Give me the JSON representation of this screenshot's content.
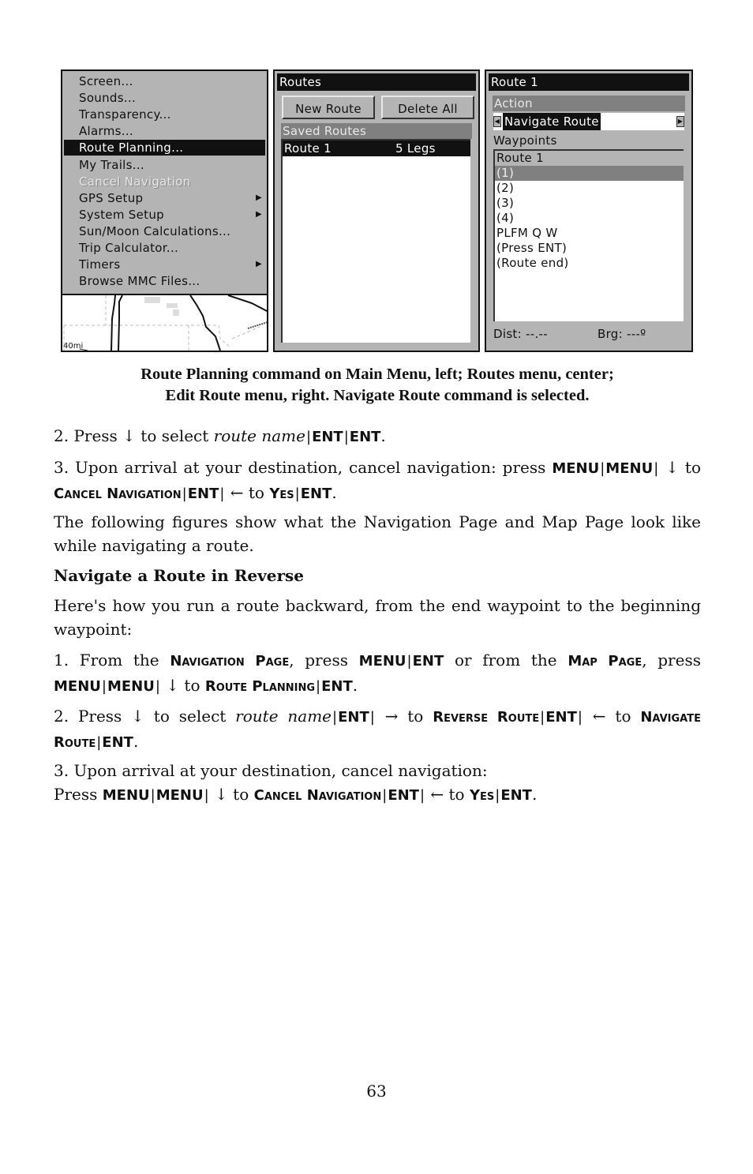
{
  "figures": {
    "main_menu": {
      "items": [
        {
          "label": "Screen...",
          "submenu": false,
          "state": "normal"
        },
        {
          "label": "Sounds...",
          "submenu": false,
          "state": "normal"
        },
        {
          "label": "Transparency...",
          "submenu": false,
          "state": "normal"
        },
        {
          "label": "Alarms...",
          "submenu": false,
          "state": "normal"
        },
        {
          "label": "Route Planning...",
          "submenu": false,
          "state": "selected"
        },
        {
          "label": "My Trails...",
          "submenu": false,
          "state": "normal"
        },
        {
          "label": "Cancel Navigation",
          "submenu": false,
          "state": "disabled"
        },
        {
          "label": "GPS Setup",
          "submenu": true,
          "state": "normal"
        },
        {
          "label": "System Setup",
          "submenu": true,
          "state": "normal"
        },
        {
          "label": "Sun/Moon Calculations...",
          "submenu": false,
          "state": "normal"
        },
        {
          "label": "Trip Calculator...",
          "submenu": false,
          "state": "normal"
        },
        {
          "label": "Timers",
          "submenu": true,
          "state": "normal"
        },
        {
          "label": "Browse MMC Files...",
          "submenu": false,
          "state": "normal"
        }
      ],
      "submenu_arrow": "▶",
      "map_scale": "40mi"
    },
    "routes_menu": {
      "title": "Routes",
      "new_route_button": "New Route",
      "delete_all_button": "Delete All",
      "saved_routes_header": "Saved Routes",
      "routes": [
        {
          "name": "Route 1",
          "legs": "5 Legs",
          "selected": true
        }
      ]
    },
    "edit_route_menu": {
      "title": "Route 1",
      "action_header": "Action",
      "action_value": "Navigate Route",
      "left_arrow": "◀",
      "right_arrow": "▶",
      "waypoints_header": "Waypoints",
      "waypoints": [
        {
          "label": "Route 1",
          "style": "header"
        },
        {
          "label": "(1)",
          "style": "highlight"
        },
        {
          "label": "(2)",
          "style": "normal"
        },
        {
          "label": "(3)",
          "style": "normal"
        },
        {
          "label": "(4)",
          "style": "normal"
        },
        {
          "label": "PLFM Q W",
          "style": "normal"
        },
        {
          "label": "(Press ENT)",
          "style": "normal"
        },
        {
          "label": "(Route end)",
          "style": "normal"
        }
      ],
      "dist_label": "Dist: --.--",
      "brg_label": "Brg: ---º"
    }
  },
  "caption": {
    "line1": "Route Planning command on Main Menu, left; Routes  menu, center;",
    "line2": "Edit Route menu, right. Navigate Route command is selected."
  },
  "text": {
    "step2_a": "2. Press ↓ to select ",
    "step2_route_name": "route name",
    "ent": "ENT",
    "menu": "MENU",
    "sep": "|",
    "step3_a": "3.  Upon  arrival  at  your  destination,  cancel  navigation: press ",
    "down_to": " ↓ to ",
    "cancel_navigation": "Cancel Navigation",
    "left_to": " ← to ",
    "right_to": " → to ",
    "yes": "Yes",
    "period": ".",
    "para_figures": "The following figures show what the Navigation Page and Map Page look like while navigating a route.",
    "heading": "Navigate a Route in Reverse",
    "para_intro": "Here's how you run a route backward, from the end waypoint to the beginning waypoint:",
    "r1_a": "1. From the ",
    "navigation_page": "Navigation Page",
    "r1_b": ", press ",
    "r1_c": " or from the ",
    "map_page": "Map Page",
    "r1_d": ", press ",
    "route_planning": "Route Planning",
    "r2_a": "2. Press ↓ to select ",
    "reverse_route": "Reverse Route",
    "navigate_route": "Navigate Route",
    "r3_line1": "3. Upon arrival at your destination, cancel navigation:",
    "r3_b": "Press "
  },
  "page_number": "63"
}
